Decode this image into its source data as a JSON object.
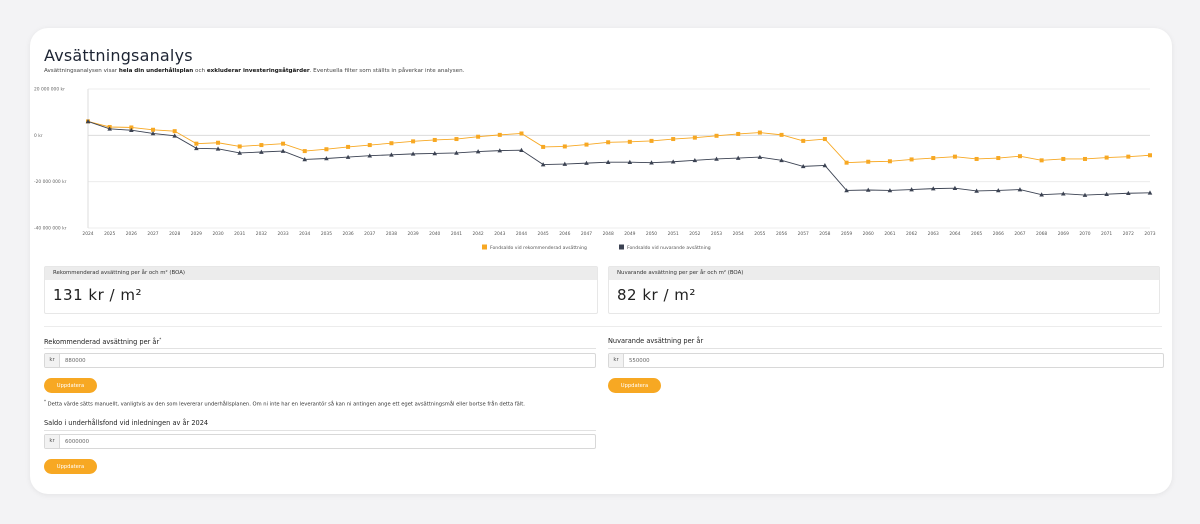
{
  "title": "Avsättningsanalys",
  "subtitle": {
    "t1": "Avsättningsanalysen visar ",
    "b1": "hela din underhållsplan",
    "t2": " och ",
    "b2": "exkluderar investeringsåtgärder",
    "t3": ". Eventuella filter som ställts in påverkar inte analysen."
  },
  "colors": {
    "orange": "#f7a823",
    "dark": "#3b4252",
    "grid": "#e9e9e9"
  },
  "chart_data": {
    "type": "line",
    "x": [
      "2024",
      "2025",
      "2026",
      "2027",
      "2028",
      "2029",
      "2030",
      "2031",
      "2032",
      "2033",
      "2034",
      "2035",
      "2036",
      "2037",
      "2038",
      "2039",
      "2040",
      "2041",
      "2042",
      "2043",
      "2044",
      "2045",
      "2046",
      "2047",
      "2048",
      "2049",
      "2050",
      "2051",
      "2052",
      "2053",
      "2054",
      "2055",
      "2056",
      "2057",
      "2058",
      "2059",
      "2060",
      "2061",
      "2062",
      "2063",
      "2064",
      "2065",
      "2066",
      "2067",
      "2068",
      "2069",
      "2070",
      "2071",
      "2072",
      "2073"
    ],
    "ylim": [
      -40000000,
      20000000
    ],
    "yticks": [
      {
        "value": 20000000,
        "label": "20 000 000 kr"
      },
      {
        "value": 0,
        "label": "0 kr"
      },
      {
        "value": -20000000,
        "label": "-20 000 000 kr"
      },
      {
        "value": -40000000,
        "label": "-40 000 000 kr"
      }
    ],
    "series": [
      {
        "name": "Fondsaldo vid rekommenderad avsättning",
        "color": "#f7a823",
        "marker": "square",
        "values": [
          6000000,
          3600000,
          3400000,
          2400000,
          1800000,
          -3600000,
          -3200000,
          -4800000,
          -4200000,
          -3600000,
          -6800000,
          -6000000,
          -5000000,
          -4200000,
          -3400000,
          -2600000,
          -2000000,
          -1600000,
          -600000,
          200000,
          800000,
          -5000000,
          -4800000,
          -4000000,
          -3000000,
          -2800000,
          -2400000,
          -1600000,
          -1000000,
          -200000,
          600000,
          1200000,
          200000,
          -2400000,
          -1600000,
          -11800000,
          -11400000,
          -11200000,
          -10400000,
          -9800000,
          -9200000,
          -10200000,
          -9800000,
          -9000000,
          -10800000,
          -10200000,
          -10200000,
          -9600000,
          -9200000,
          -8600000
        ]
      },
      {
        "name": "Fondsaldo vid nuvarande avsättning",
        "color": "#3b4252",
        "marker": "triangle",
        "values": [
          6000000,
          2800000,
          2200000,
          800000,
          -200000,
          -5600000,
          -5800000,
          -7600000,
          -7200000,
          -6800000,
          -10400000,
          -10000000,
          -9400000,
          -8800000,
          -8400000,
          -8000000,
          -7800000,
          -7600000,
          -7000000,
          -6600000,
          -6400000,
          -12600000,
          -12400000,
          -12000000,
          -11600000,
          -11600000,
          -11800000,
          -11400000,
          -10800000,
          -10200000,
          -9800000,
          -9400000,
          -10800000,
          -13400000,
          -13000000,
          -23800000,
          -23600000,
          -23800000,
          -23400000,
          -23000000,
          -22800000,
          -24000000,
          -23800000,
          -23400000,
          -25600000,
          -25200000,
          -25800000,
          -25400000,
          -25000000,
          -24800000
        ]
      }
    ],
    "legend_position": "bottom-center",
    "grid": true
  },
  "stats": {
    "recommended": {
      "label": "Rekommenderad avsättning per år och m² (BOA)",
      "value": "131 kr / m²"
    },
    "current": {
      "label": "Nuvarande avsättning per per år och m² (BOA)",
      "value": "82 kr / m²"
    }
  },
  "form": {
    "recommended_label": "Rekommenderad avsättning per år",
    "recommended_asterisk": "*",
    "recommended_value": "880000",
    "current_label": "Nuvarande avsättning per år",
    "current_value": "550000",
    "currency": "kr",
    "update_label": "Uppdatera",
    "footnote_mark": "*",
    "footnote": " Detta värde sätts manuellt, vanligtvis av den som levererar underhållsplanen. Om ni inte har en leverantör så kan ni antingen ange ett eget avsättningsmål eller bortse från detta fält.",
    "balance_label": "Saldo i underhållsfond vid inledningen av år 2024",
    "balance_value": "6000000"
  }
}
